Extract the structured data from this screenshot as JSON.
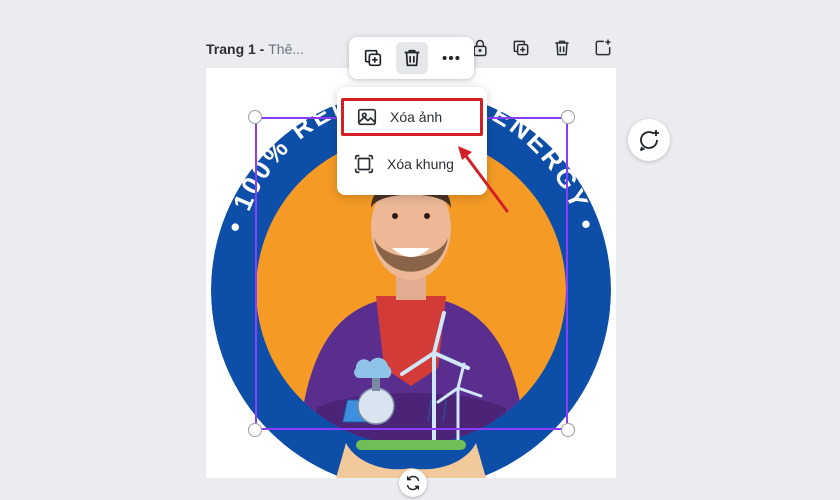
{
  "page_header": {
    "name": "Trang 1 - ",
    "title": "Thê..."
  },
  "page_actions": [
    {
      "icon": "lock-icon"
    },
    {
      "icon": "duplicate-page-icon"
    },
    {
      "icon": "trash-icon"
    },
    {
      "icon": "add-page-icon"
    }
  ],
  "element_toolbar": [
    {
      "icon": "duplicate-icon"
    },
    {
      "icon": "trash-icon",
      "active": true
    },
    {
      "icon": "more-icon"
    }
  ],
  "context_menu": {
    "items": [
      {
        "icon": "image-icon",
        "label": "Xóa ảnh",
        "highlighted": true
      },
      {
        "icon": "frame-icon",
        "label": "Xóa khung",
        "highlighted": false
      }
    ]
  },
  "design": {
    "ring_text": "• 100% RENEWABLE ENERGY •",
    "colors": {
      "ring": "#0d4fa8",
      "backdrop": "#f49a25",
      "hoodie": "#5a2e8f",
      "shirt": "#d33b38",
      "selection": "#8b3dff",
      "highlight": "#d32027"
    }
  },
  "comment_button": {
    "icon": "add-comment-icon"
  },
  "rotate_button": {
    "icon": "rotate-icon"
  }
}
